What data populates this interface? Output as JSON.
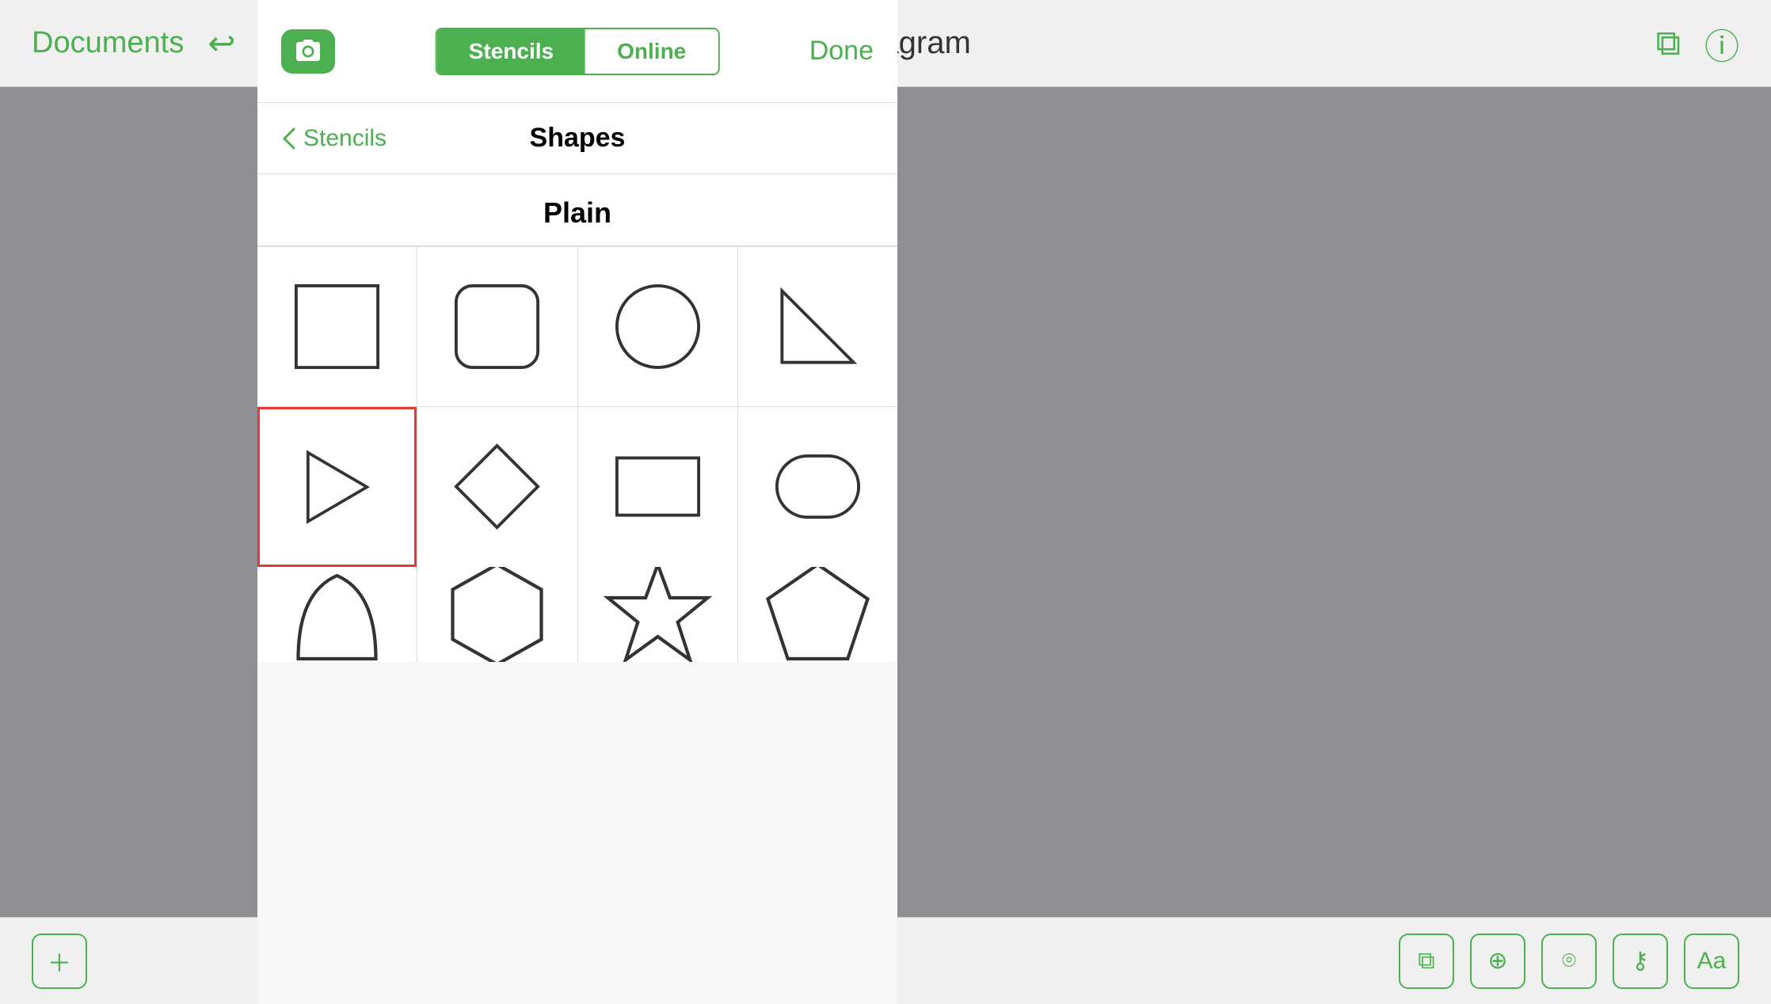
{
  "app": {
    "title": "My Diagram",
    "documents_label": "Documents"
  },
  "modal": {
    "camera_icon": "📷",
    "segment": {
      "stencils_label": "Stencils",
      "online_label": "Online",
      "active": "stencils"
    },
    "done_label": "Done",
    "back_label": "Stencils",
    "page_title": "Shapes",
    "section_title": "Plain"
  },
  "shapes": {
    "row1": [
      {
        "id": "square",
        "label": "Square"
      },
      {
        "id": "rounded-square",
        "label": "Rounded Square"
      },
      {
        "id": "circle",
        "label": "Circle"
      },
      {
        "id": "right-triangle",
        "label": "Right Triangle"
      }
    ],
    "row2": [
      {
        "id": "play-triangle",
        "label": "Play Triangle",
        "selected": true
      },
      {
        "id": "diamond",
        "label": "Diamond"
      },
      {
        "id": "rectangle",
        "label": "Rectangle"
      },
      {
        "id": "stadium",
        "label": "Stadium"
      }
    ],
    "row3_partial": [
      {
        "id": "arc",
        "label": "Arc"
      },
      {
        "id": "hexagon",
        "label": "Hexagon"
      },
      {
        "id": "star",
        "label": "Star"
      },
      {
        "id": "pentagon",
        "label": "Pentagon"
      }
    ]
  },
  "toolbar": {
    "add_label": "+",
    "items": [
      "layers",
      "plus-circle",
      "lasso",
      "key",
      "font"
    ]
  },
  "colors": {
    "green": "#4CAF50",
    "red": "#e53935",
    "border": "#ddd",
    "bg": "#8e8e93"
  }
}
